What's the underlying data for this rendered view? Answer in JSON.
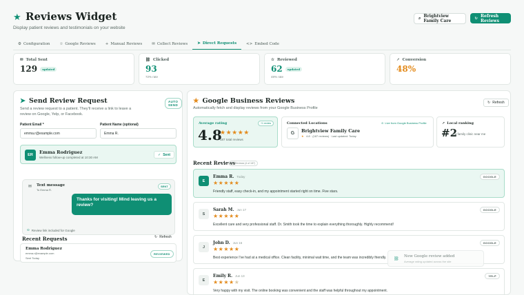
{
  "header": {
    "title": "Reviews Widget",
    "subtitle": "Display patient reviews and testimonials on your website",
    "location_button": "Brightview Family Care",
    "refresh_button": "Refresh Reviews"
  },
  "tabs": [
    {
      "label": "Configuration",
      "icon": "gear-icon"
    },
    {
      "label": "Google Reviews",
      "icon": "star-icon"
    },
    {
      "label": "Manual Reviews",
      "icon": "plus-icon"
    },
    {
      "label": "Collect Reviews",
      "icon": "mail-icon"
    },
    {
      "label": "Direct Requests",
      "icon": "send-icon",
      "active": true
    },
    {
      "label": "Embed Code",
      "icon": "code-icon"
    }
  ],
  "stats": [
    {
      "label": "Total Sent",
      "value": "129",
      "badge": "updated",
      "sub": ""
    },
    {
      "label": "Clicked",
      "value": "93",
      "badge": "",
      "sub": "72% rate"
    },
    {
      "label": "Reviewed",
      "value": "62",
      "badge": "updated",
      "sub": "48% rate"
    },
    {
      "label": "Conversion",
      "value": "48%",
      "badge": "",
      "sub": ""
    }
  ],
  "send_panel": {
    "title": "Send Review Request",
    "auto_send": "AUTO SEND",
    "description": "Send a review request to a patient. They'll receive a link to leave a review on Google, Yelp, or Facebook.",
    "email_label": "Patient Email *",
    "email_value": "emma.r@example.com",
    "name_label": "Patient Name (optional)",
    "name_value": "Emma R.",
    "selected": {
      "initials": "ER",
      "name": "Emma Rodriguez",
      "detail": "Wellness follow-up completed at 10:30 AM",
      "status": "Sent"
    },
    "preview": {
      "title": "Text message",
      "to": "To Emma R.",
      "tag": "SENT",
      "bubble": "Thanks for visiting! Mind leaving us a review?",
      "footer": "Review link included for Google"
    },
    "recent_title": "Recent Requests",
    "recent_refresh": "Refresh",
    "recent": {
      "name": "Emma Rodriguez",
      "email": "emma.r@example.com",
      "when": "Sent Today",
      "status": "REVIEWED"
    }
  },
  "google_panel": {
    "title": "Google Business Reviews",
    "subtitle": "Automatically fetch and display reviews from your Google Business Profile",
    "refresh": "Refresh",
    "avg_label": "Average rating",
    "avg_badge": "+1 review",
    "avg_value": "4.8",
    "avg_total": "187 total reviews",
    "loc_label": "Connected Locations",
    "loc_live": "Live from Google Business Profile",
    "loc_initial": "G",
    "loc_name": "Brightview Family Care",
    "loc_meta": "4.8 · (187 reviews) · Last updated: Today",
    "rank_label": "Local ranking",
    "rank_value": "#2",
    "rank_sub": "for family clinic near me",
    "recent_title": "Recent Reviews",
    "recent_count": "16 Reviews (4 of 187)",
    "reviews": [
      {
        "initial": "E",
        "name": "Emma R.",
        "date": "Today",
        "rating": 5,
        "text": "Friendly staff, easy check-in, and my appointment started right on time. Five stars.",
        "source": "GOOGLE"
      },
      {
        "initial": "S",
        "name": "Sarah M.",
        "date": "Jun 17",
        "rating": 5,
        "text": "Excellent care and very professional staff. Dr. Smith took the time to explain everything thoroughly. Highly recommend!",
        "source": "GOOGLE"
      },
      {
        "initial": "J",
        "name": "John D.",
        "date": "Jun 16",
        "rating": 5,
        "text": "Best experience I've had at a medical office. Clean facility, minimal wait time, and the team was incredibly friendly.",
        "source": "GOOGLE"
      },
      {
        "initial": "E",
        "name": "Emily R.",
        "date": "Jun 13",
        "rating": 4,
        "text": "Very happy with my visit. The online booking was convenient and the staff was helpful throughout my appointment.",
        "source": "YELP"
      }
    ]
  },
  "toast": {
    "title": "New Google review added",
    "body": "Average rating updated across the site"
  },
  "colors": {
    "accent": "#0f8f74",
    "star": "#e38b1d",
    "conversion": "#e38b1d"
  }
}
